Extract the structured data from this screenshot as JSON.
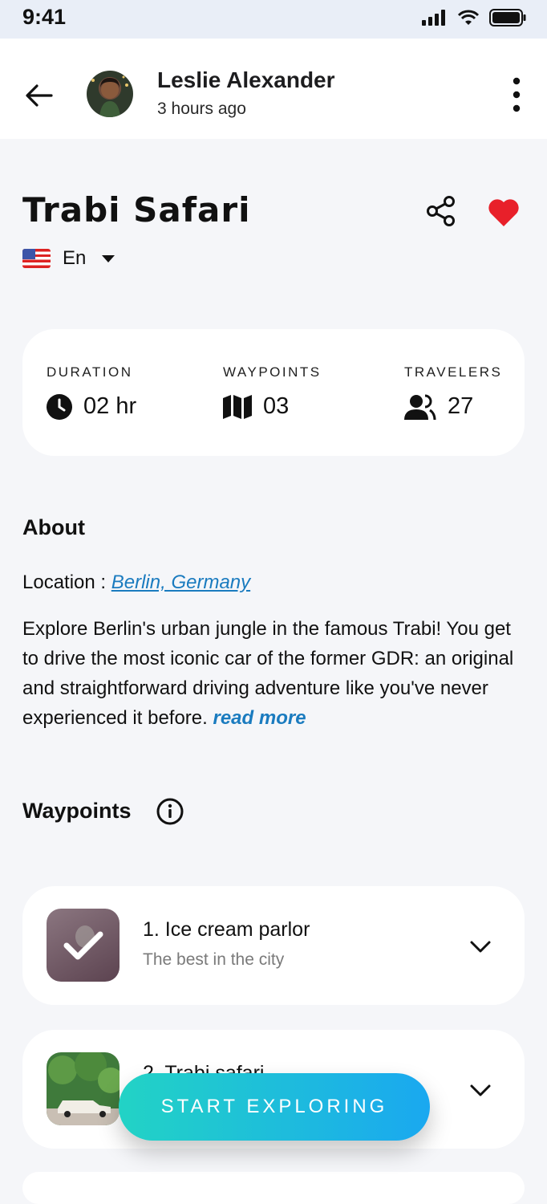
{
  "status_bar": {
    "time": "9:41"
  },
  "header": {
    "author_name": "Leslie Alexander",
    "posted_time": "3 hours ago",
    "icons": [
      "arrow-left-icon",
      "avatar",
      "more-vertical-icon"
    ]
  },
  "tour": {
    "title": "Trabi Safari",
    "language": "En",
    "favorited": true
  },
  "stats": [
    {
      "label": "DURATION",
      "value": "02 hr",
      "icon": "clock-icon"
    },
    {
      "label": "WAYPOINTS",
      "value": "03",
      "icon": "map-icon"
    },
    {
      "label": "TRAVELERS",
      "value": "27",
      "icon": "users-icon"
    }
  ],
  "about": {
    "heading": "About",
    "location_label": "Location : ",
    "location_value": "Berlin, Germany",
    "description": "Explore Berlin's urban jungle in the famous Trabi! You get to drive the most iconic car of the former GDR: an original and straightforward driving adventure like you've never experienced it before. ",
    "read_more": "read more"
  },
  "waypoints": {
    "heading": "Waypoints",
    "items": [
      {
        "title": "1. Ice cream parlor",
        "subtitle": "The best in the city",
        "completed": true
      },
      {
        "title": "2. Trabi safari",
        "subtitle": "",
        "completed": false
      }
    ]
  },
  "cta": {
    "label": "START EXPLORING"
  },
  "colors": {
    "accent": "#1a7bbf",
    "heart": "#e8202a",
    "cta_start": "#22d3c5",
    "cta_end": "#1aa8f0"
  }
}
